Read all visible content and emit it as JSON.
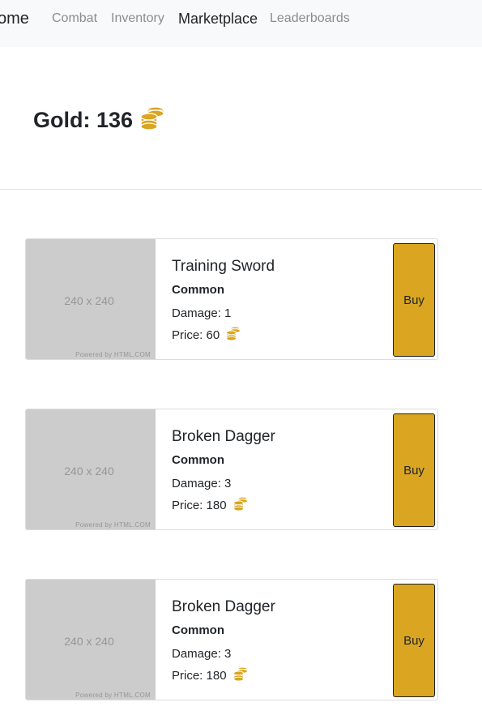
{
  "nav": {
    "brand": "ome",
    "links": [
      {
        "label": "Combat"
      },
      {
        "label": "Inventory"
      },
      {
        "label": "Marketplace"
      },
      {
        "label": "Leaderboards"
      }
    ]
  },
  "player": {
    "gold_label": "Gold: 136",
    "gold_icon": "coin-stack-icon"
  },
  "colors": {
    "accent": "#daa520",
    "navbar_bg": "#f8f9fa",
    "placeholder_bg": "#cccccc"
  },
  "items": [
    {
      "image_label": "240 x 240",
      "image_credit": "Powered by HTML.COM",
      "name": "Training Sword",
      "rarity": "Common",
      "damage": "Damage: 1",
      "price": "Price: 60",
      "buy_label": "Buy"
    },
    {
      "image_label": "240 x 240",
      "image_credit": "Powered by HTML.COM",
      "name": "Broken Dagger",
      "rarity": "Common",
      "damage": "Damage: 3",
      "price": "Price: 180",
      "buy_label": "Buy"
    },
    {
      "image_label": "240 x 240",
      "image_credit": "Powered by HTML.COM",
      "name": "Broken Dagger",
      "rarity": "Common",
      "damage": "Damage: 3",
      "price": "Price: 180",
      "buy_label": "Buy"
    }
  ]
}
